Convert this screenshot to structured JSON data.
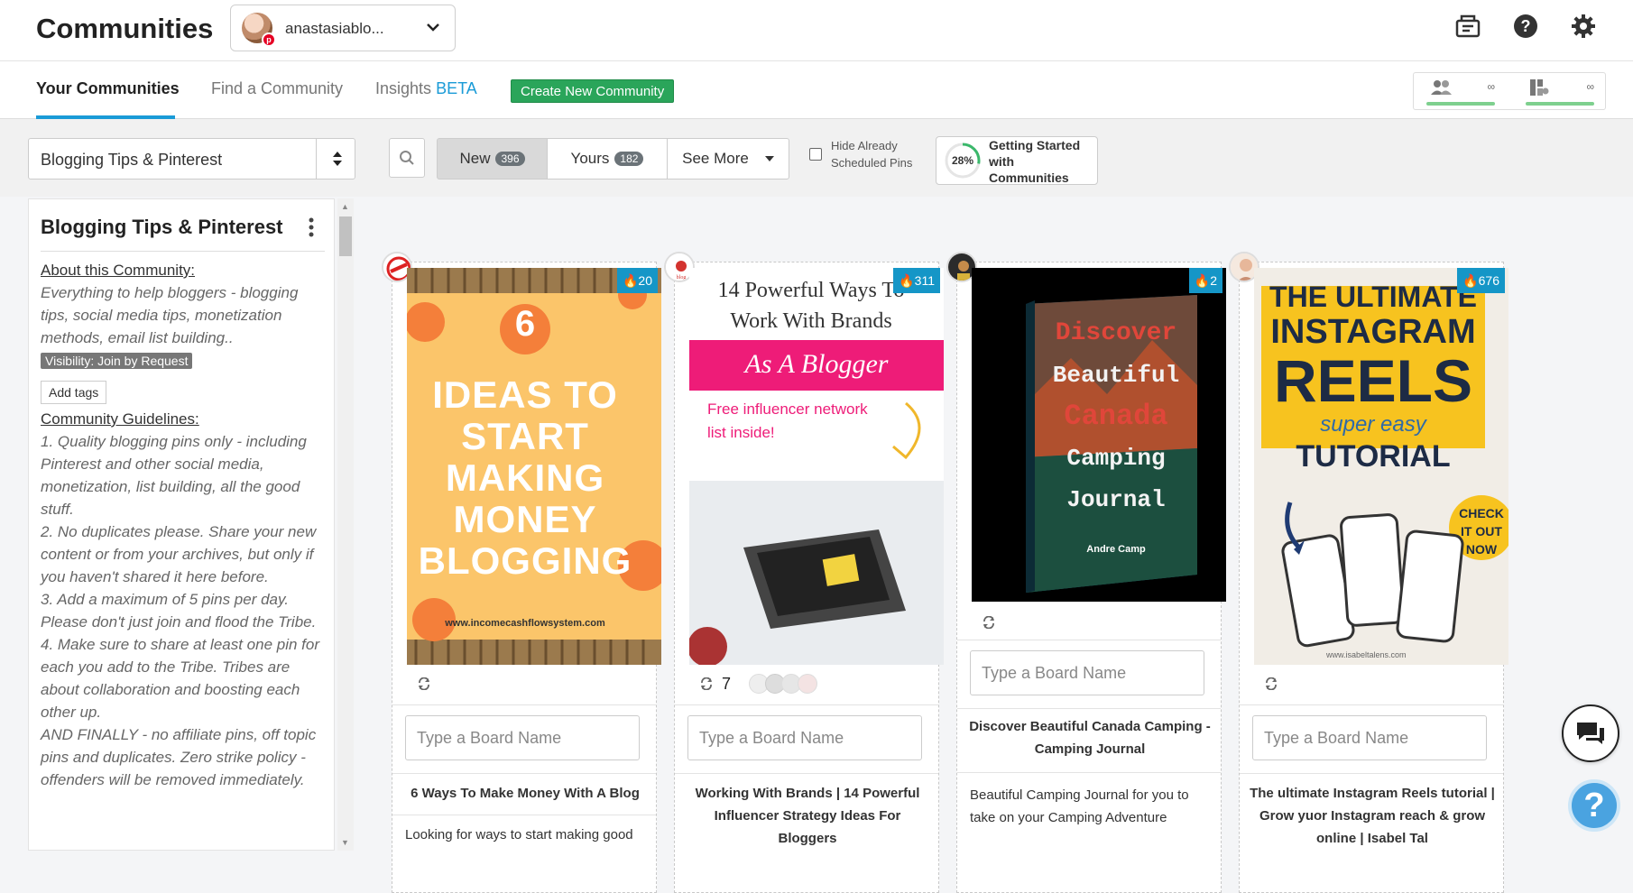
{
  "header": {
    "app_title": "Communities",
    "account_name": "anastasiablo...",
    "icons": [
      "card-icon",
      "help-icon",
      "settings-icon"
    ]
  },
  "tabs": {
    "your_communities": "Your Communities",
    "find_community": "Find a Community",
    "insights": "Insights",
    "insights_badge": "BETA",
    "create_button": "Create New Community",
    "quota": [
      {
        "icon": "members-icon",
        "value": "∞"
      },
      {
        "icon": "boards-icon",
        "value": "∞"
      }
    ]
  },
  "filters": {
    "community_selected": "Blogging Tips & Pinterest",
    "segments": [
      {
        "label": "New",
        "count": "396"
      },
      {
        "label": "Yours",
        "count": "182"
      },
      {
        "label": "See More",
        "count": ""
      }
    ],
    "hide_scheduled_line1": "Hide Already",
    "hide_scheduled_line2": "Scheduled Pins",
    "getting_started_percent": "28%",
    "getting_started_line1": "Getting Started",
    "getting_started_line2": "with",
    "getting_started_line3": "Communities",
    "progress_fraction": 0.28
  },
  "sidebar": {
    "title": "Blogging Tips & Pinterest",
    "about_heading": "About this Community:",
    "about_text": "Everything to help bloggers - blogging tips, social media tips, monetization methods, email list building..",
    "visibility": "Visibility: Join by Request",
    "add_tags": "Add tags",
    "guidelines_heading": "Community Guidelines:",
    "guidelines": [
      "1. Quality blogging pins only - including Pinterest and other social media, monetization, list building, all the good stuff.",
      "2. No duplicates please. Share your new content or from your archives, but only if you haven't shared it here before.",
      "3. Add a maximum of 5 pins per day. Please don't just join and flood the Tribe.",
      "4. Make sure to share at least one pin for each you add to the Tribe. Tribes are about collaboration and boosting each other up.",
      "AND FINALLY - no affiliate pins, off topic pins and duplicates. Zero strike policy - offenders will be removed immediately."
    ]
  },
  "pins": [
    {
      "heat": "20",
      "image_text": {
        "num": "6",
        "l1": "IDEAS TO",
        "l2": "START",
        "l3": "MAKING",
        "l4": "MONEY",
        "l5": "BLOGGING",
        "url": "www.incomecashflowsystem.com"
      },
      "board_placeholder": "Type a Board Name",
      "title": "6 Ways To Make Money With A Blog",
      "desc": "Looking for ways to start making good"
    },
    {
      "heat": "311",
      "image_text": {
        "l1": "14 Powerful Ways To",
        "l2": "Work With Brands",
        "l3": "As A Blogger",
        "l4": "Free influencer network",
        "l5": "list inside!"
      },
      "shares": "7",
      "board_placeholder": "Type a Board Name",
      "title": "Working With Brands | 14 Powerful Influencer Strategy Ideas For Bloggers",
      "desc": ""
    },
    {
      "heat": "2",
      "image_text": {
        "l1": "Discover",
        "l2": "Beautiful",
        "l3": "Canada",
        "l4": "Camping",
        "l5": "Journal",
        "author": "Andre Camp"
      },
      "board_placeholder": "Type a Board Name",
      "title": "Discover Beautiful Canada Camping - Camping Journal",
      "desc": "Beautiful Camping Journal for you to take on your Camping Adventure"
    },
    {
      "heat": "676",
      "image_text": {
        "l1": "THE ULTIMATE",
        "l2": "INSTAGRAM",
        "l3": "REELS",
        "l4": "super easy",
        "l5": "TUTORIAL",
        "check1": "CHECK",
        "check2": "IT OUT",
        "check3": "NOW",
        "url": "www.isabeltalens.com"
      },
      "board_placeholder": "Type a Board Name",
      "title": "The ultimate Instagram Reels tutorial | Grow yuor Instagram reach & grow online | Isabel Tal",
      "desc": ""
    }
  ],
  "colors": {
    "accent": "#1a9bd7",
    "create": "#2aa55a",
    "heat": "#1596c7",
    "help": "#4aa3e0"
  }
}
